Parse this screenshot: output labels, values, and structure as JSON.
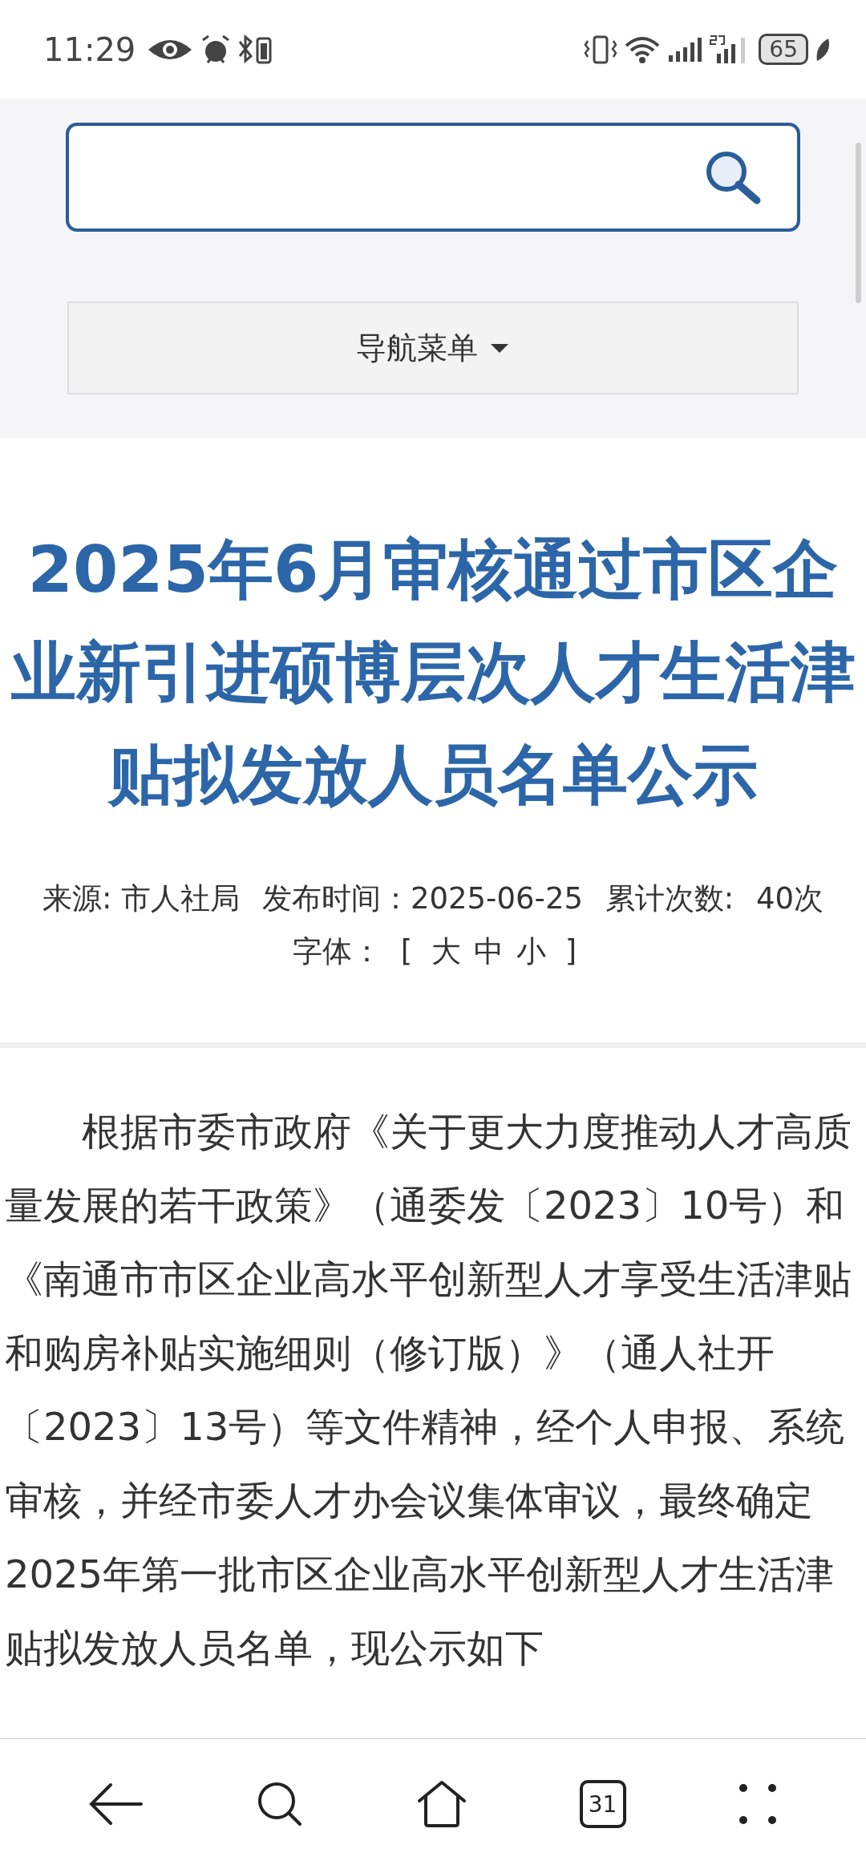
{
  "status_bar": {
    "time": "11:29",
    "battery": "65"
  },
  "nav_menu": {
    "label": "导航菜单"
  },
  "article": {
    "title": "2025年6月审核通过市区企业新引进硕博层次人才生活津贴拟发放人员名单公示",
    "meta": {
      "source": "来源: 市人社局",
      "published": "发布时间：2025-06-25",
      "views_label": "累计次数:",
      "views": "40次",
      "font_label": "字体：",
      "bracket_open": "[",
      "font_sizes": [
        "大",
        "中",
        "小"
      ],
      "bracket_close": "]"
    },
    "body": "根据市委市政府《关于更大力度推动人才高质量发展的若干政策》（通委发〔2023〕10号）和《南通市市区企业高水平创新型人才享受生活津贴和购房补贴实施细则（修订版）》（通人社开〔2023〕13号）等文件精神，经个人申报、系统审核，并经市委人才办会议集体审议，最终确定2025年第一批市区企业高水平创新型人才生活津贴拟发放人员名单，现公示如下"
  },
  "bottom_nav": {
    "tab_count": "31"
  }
}
